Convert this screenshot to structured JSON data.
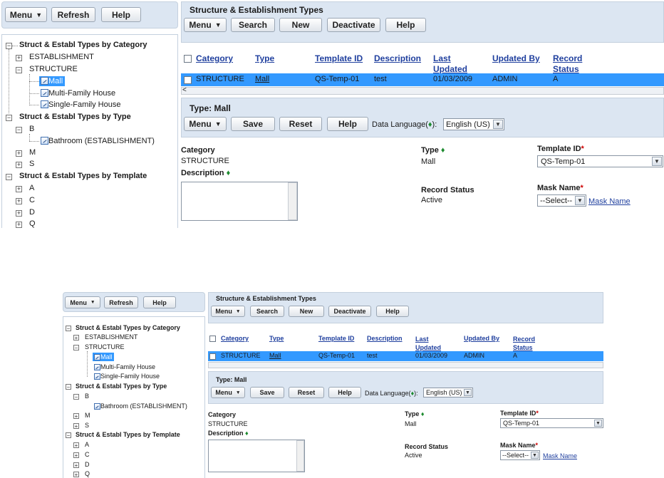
{
  "toolbar": {
    "menu": "Menu",
    "refresh": "Refresh",
    "help": "Help"
  },
  "main": {
    "title": "Structure & Establishment Types",
    "buttons": {
      "menu": "Menu",
      "search": "Search",
      "new": "New",
      "deactivate": "Deactivate",
      "help": "Help"
    }
  },
  "tree": {
    "category_header": "Struct & Establ Types by Category",
    "establishment": "ESTABLISHMENT",
    "structure": "STRUCTURE",
    "mall": "Mall",
    "multi_family": "Multi-Family House",
    "single_family": "Single-Family House",
    "type_header": "Struct & Establ Types by Type",
    "b": "B",
    "bathroom": "Bathroom (ESTABLISHMENT)",
    "m": "M",
    "s": "S",
    "template_header": "Struct & Establ Types by Template",
    "a": "A",
    "c": "C",
    "d": "D",
    "q": "Q"
  },
  "grid": {
    "headers": {
      "category": "Category",
      "type": "Type",
      "template_id": "Template ID",
      "description": "Description",
      "last_updated_1": "Last",
      "last_updated_2": "Updated",
      "updated_by": "Updated By",
      "record_status_1": "Record",
      "record_status_2": "Status"
    },
    "row": {
      "category": "STRUCTURE",
      "type": "Mall",
      "template_id": "QS-Temp-01",
      "description": "test",
      "last_updated": "01/03/2009",
      "updated_by": "ADMIN",
      "record_status": "A"
    }
  },
  "detail": {
    "title": "Type: Mall",
    "buttons": {
      "menu": "Menu",
      "save": "Save",
      "reset": "Reset",
      "help": "Help"
    },
    "data_language_pre": "Data Language(",
    "data_language_post": "):",
    "data_language_value": "English (US)",
    "category_label": "Category",
    "category_value": "STRUCTURE",
    "description_label": "Description",
    "type_label": "Type",
    "type_value": "Mall",
    "record_status_label": "Record Status",
    "record_status_value": "Active",
    "template_id_label": "Template ID",
    "template_id_value": "QS-Temp-01",
    "mask_name_label": "Mask Name",
    "mask_name_value": "--Select--",
    "mask_name_link": "Mask Name"
  },
  "symbols": {
    "diamond": "♦",
    "required": "*",
    "dropdown": "▼",
    "expander": "−",
    "collapsed": "+"
  }
}
